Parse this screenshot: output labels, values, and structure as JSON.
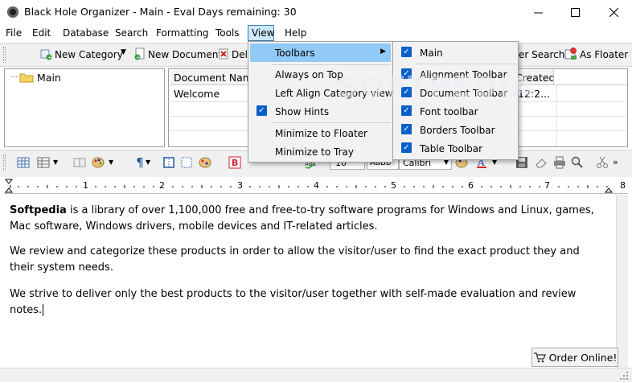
{
  "window": {
    "title": "Black Hole Organizer - Main - Eval Days remaining: 30"
  },
  "menubar": {
    "items": [
      "File",
      "Edit",
      "Database",
      "Search",
      "Formatting",
      "Tools",
      "View",
      "Help"
    ]
  },
  "main_toolbar": {
    "new_category": "New Category",
    "new_document": "New Document",
    "delete_partial": "Dele",
    "search_partial": "er Search",
    "as_floater": "As Floater"
  },
  "tree": {
    "root": "Main"
  },
  "grid": {
    "col_name": "Document Name",
    "col_created": "Created",
    "rows": [
      {
        "name": "Welcome",
        "created": "12:2..."
      }
    ]
  },
  "format_toolbar": {
    "font_size": "10",
    "font_preview": "AaBb",
    "font_name": "Calibri"
  },
  "ruler": {
    "marks": [
      "1",
      "2",
      "3",
      "4",
      "5",
      "6",
      "7",
      "8"
    ]
  },
  "document": {
    "p1_bold": "Softpedia",
    "p1_rest": " is a library of over 1,100,000 free and free-to-try software programs for Windows and Linux, games, Mac software, Windows drivers, mobile devices and IT-related articles.",
    "p2": "We review and categorize these products in order to allow the visitor/user to find the exact product they and their system needs.",
    "p3": "We strive to deliver only the best products to the visitor/user together with self-made evaluation and review notes."
  },
  "order_button": "Order Online!",
  "watermark": "SOFTPEDIA",
  "view_menu": {
    "toolbars": "Toolbars",
    "always_on_top": "Always on Top",
    "left_align": "Left Align Category view",
    "show_hints": "Show Hints",
    "minimize_floater": "Minimize to Floater",
    "minimize_tray": "Minimize to Tray"
  },
  "toolbars_submenu": {
    "items": [
      "Main",
      "Alignment Toolbar",
      "Document Toolbar",
      "Font toolbar",
      "Borders Toolbar",
      "Table Toolbar"
    ]
  }
}
